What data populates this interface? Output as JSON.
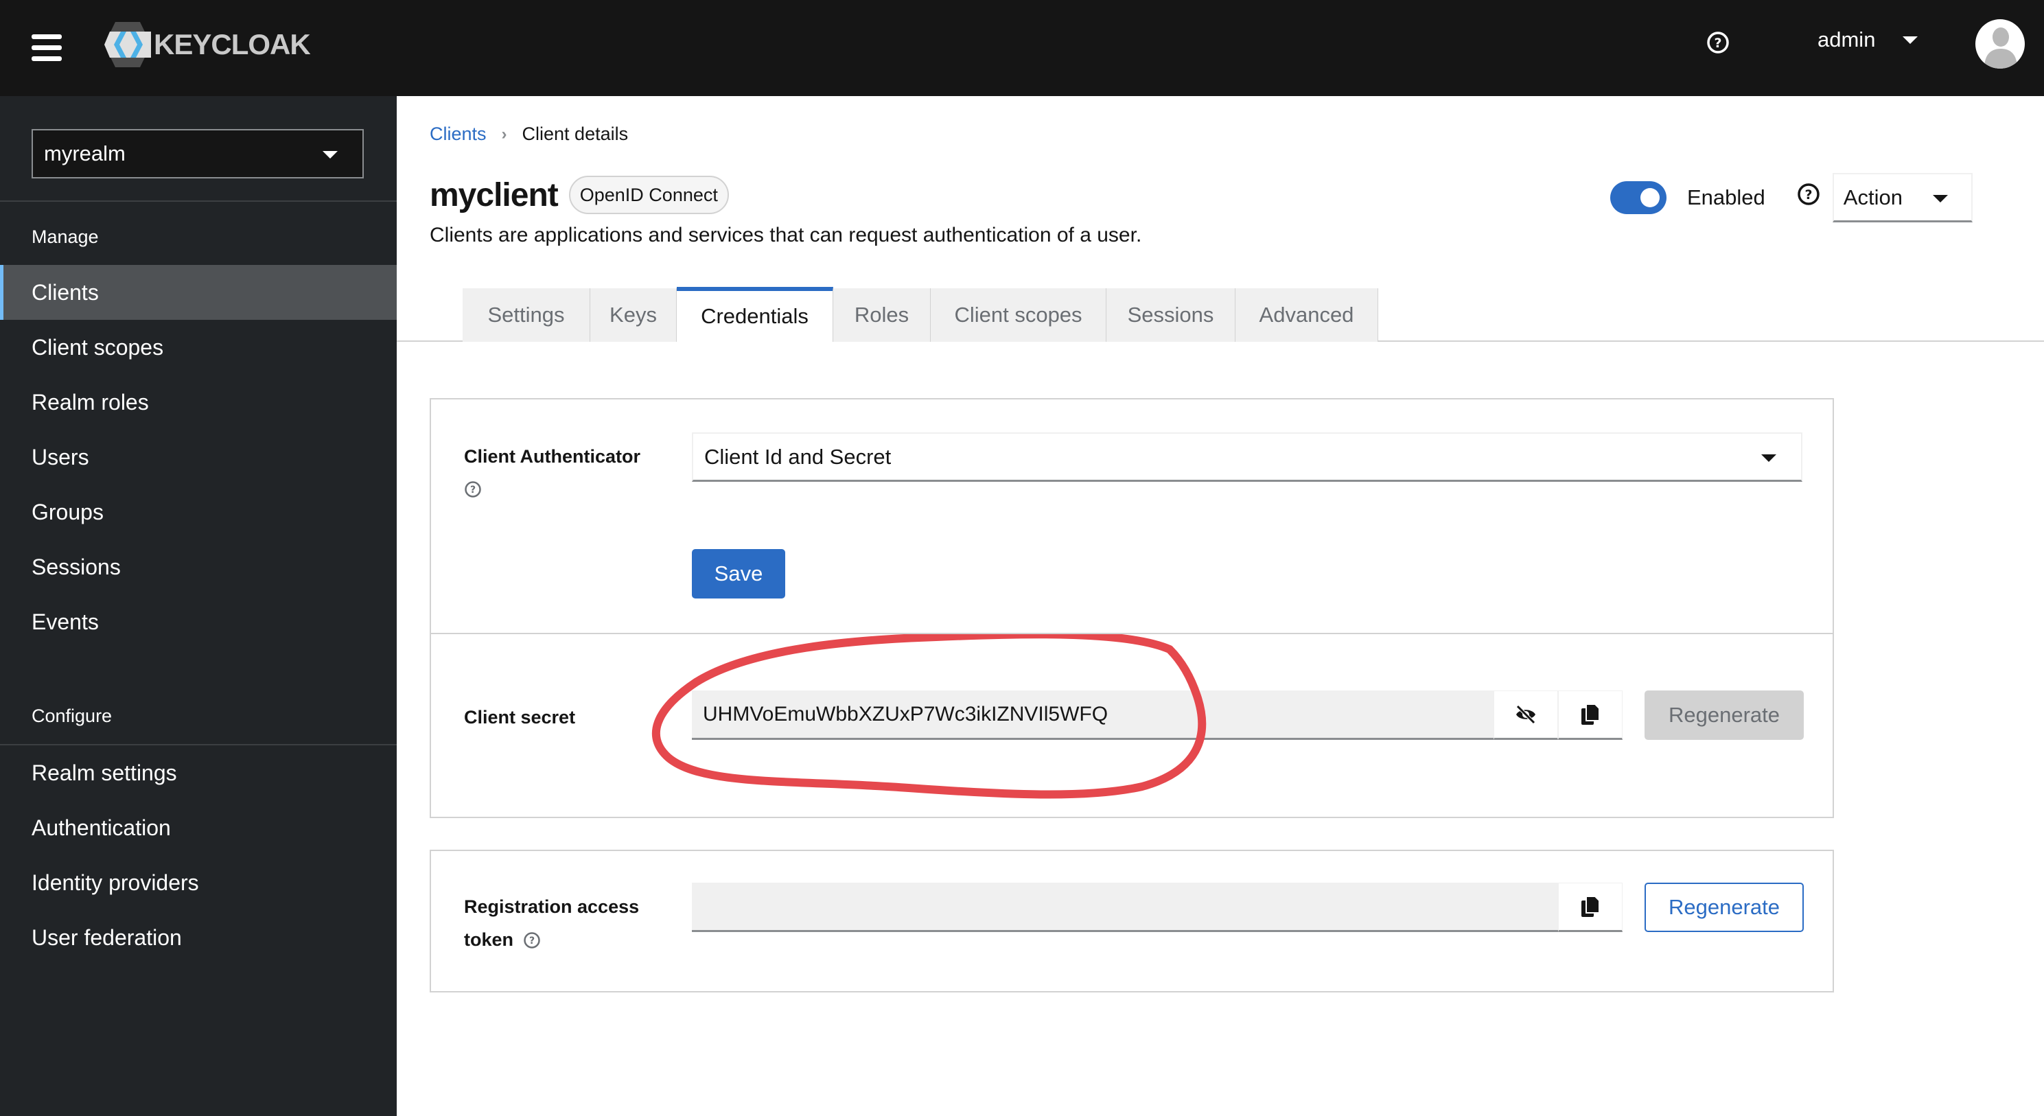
{
  "masthead": {
    "brand": "KEYCLOAK",
    "user_name": "admin"
  },
  "sidebar": {
    "realm": "myrealm",
    "sections": [
      {
        "label": "Manage",
        "items": [
          {
            "label": "Clients",
            "active": true
          },
          {
            "label": "Client scopes"
          },
          {
            "label": "Realm roles"
          },
          {
            "label": "Users"
          },
          {
            "label": "Groups"
          },
          {
            "label": "Sessions"
          },
          {
            "label": "Events"
          }
        ]
      },
      {
        "label": "Configure",
        "items": [
          {
            "label": "Realm settings"
          },
          {
            "label": "Authentication"
          },
          {
            "label": "Identity providers"
          },
          {
            "label": "User federation"
          }
        ]
      }
    ]
  },
  "breadcrumb": {
    "parent": "Clients",
    "current": "Client details"
  },
  "header": {
    "title": "myclient",
    "protocol_badge": "OpenID Connect",
    "subtitle": "Clients are applications and services that can request authentication of a user.",
    "enabled_label": "Enabled",
    "enabled": true,
    "action_label": "Action"
  },
  "tabs": [
    {
      "label": "Settings"
    },
    {
      "label": "Keys"
    },
    {
      "label": "Credentials",
      "active": true
    },
    {
      "label": "Roles"
    },
    {
      "label": "Client scopes"
    },
    {
      "label": "Sessions"
    },
    {
      "label": "Advanced"
    }
  ],
  "credentials": {
    "authenticator": {
      "label": "Client Authenticator",
      "value": "Client Id and Secret",
      "save_label": "Save"
    },
    "secret": {
      "label": "Client secret",
      "value": "UHMVoEmuWbbXZUxP7Wc3ikIZNVIl5WFQ",
      "regenerate_label": "Regenerate"
    },
    "registration_token": {
      "label_line1": "Registration access",
      "label_line2": "token",
      "value": "",
      "regenerate_label": "Regenerate"
    }
  },
  "colors": {
    "accent": "#2b6cc4",
    "annotation": "#e5484d",
    "sidebar_bg": "#212427",
    "masthead_bg": "#151515"
  }
}
